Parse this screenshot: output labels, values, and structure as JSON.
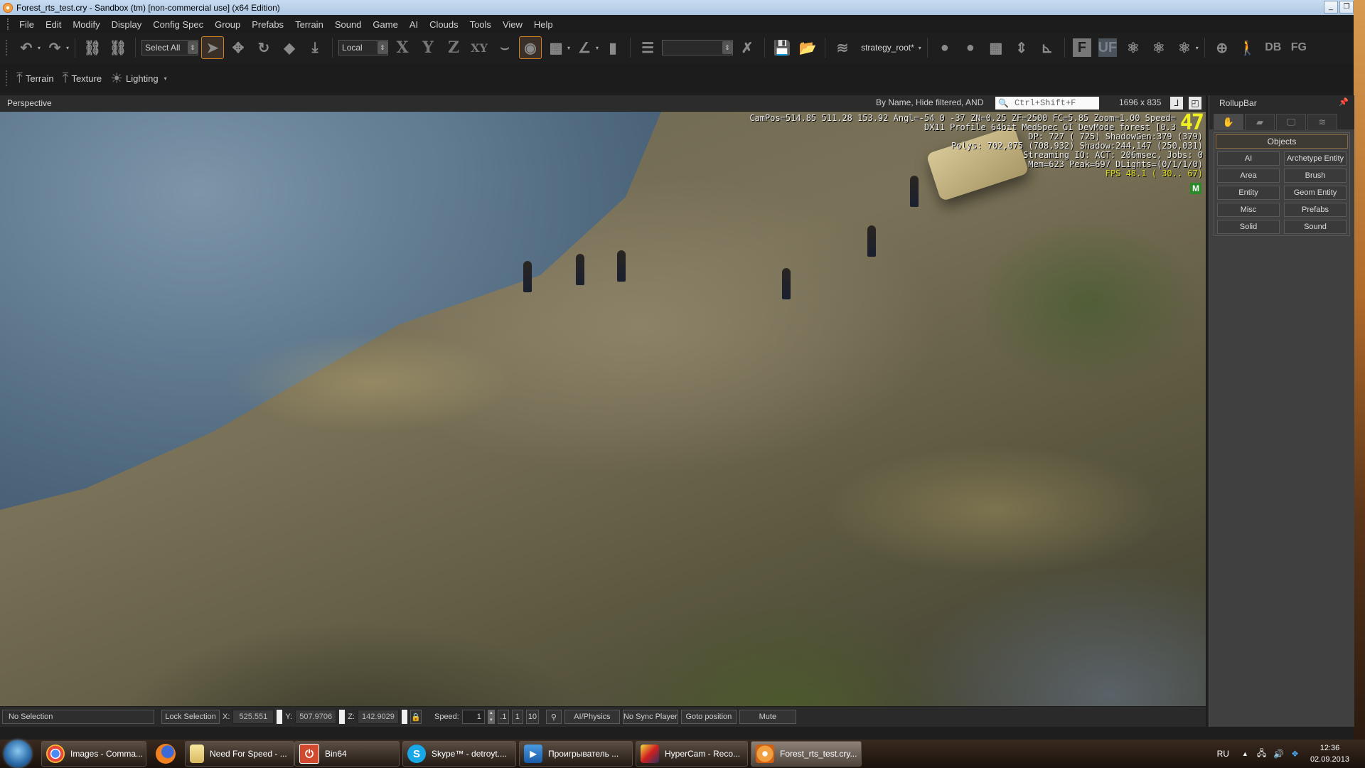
{
  "window": {
    "title": "Forest_rts_test.cry - Sandbox (tm) [non-commercial use] (x64 Edition)",
    "controls": [
      "minimize",
      "restore"
    ]
  },
  "menu": [
    "File",
    "Edit",
    "Modify",
    "Display",
    "Config Spec",
    "Group",
    "Prefabs",
    "Terrain",
    "Sound",
    "Game",
    "AI",
    "Clouds",
    "Tools",
    "View",
    "Help"
  ],
  "toolbar": {
    "selection_combo": "Select All",
    "coord_system_combo": "Local",
    "axis_x": "X",
    "axis_y": "Y",
    "axis_z": "Z",
    "axis_xy": "XY",
    "layer_name": "strategy_root*",
    "physics_f": "F",
    "physics_uf": "UF",
    "debug_db": "DB",
    "debug_fg": "FG"
  },
  "toolbar2": {
    "terrain": "Terrain",
    "texture": "Texture",
    "lighting": "Lighting"
  },
  "viewport_header": {
    "title": "Perspective",
    "filter_text": "By Name, Hide filtered, AND",
    "search_placeholder": "Ctrl+Shift+F",
    "resolution": "1696 x 835"
  },
  "hud": {
    "lines": [
      "CamPos=514.85 511.28 153.92 Angl=-54  0 -37 ZN=0.25 ZF=2500 FC=5.85 Zoom=1.00 Speed=",
      "DX11 Profile 64bit MedSpec GI DevMode forest [0.3",
      "DP:  727 ( 725) ShadowGen:379 (379)",
      "Polys: 702,075 (708,932) Shadow:244,147 (250,031)",
      "Streaming IO: ACT: 206msec, Jobs: 0",
      "Mem=623 Peak=697 DLights=(0/1/1/0)"
    ],
    "fps_line": "FPS  48.1 ( 30.. 67)",
    "speed_value": "47",
    "m_badge": "M",
    "fps_color": "#e0e020"
  },
  "statusbar": {
    "selection": "No Selection",
    "lock_selection": "Lock Selection",
    "x_label": "X:",
    "x_value": "525.551",
    "y_label": "Y:",
    "y_value": "507.9706",
    "z_label": "Z:",
    "z_value": "142.9029",
    "speed_label": "Speed:",
    "speed_value": "1",
    "speed_presets": [
      ".1",
      "1",
      "10"
    ],
    "ai_physics": "AI/Physics",
    "no_sync_player": "No Sync Player",
    "goto_position": "Goto position",
    "mute": "Mute"
  },
  "rollup": {
    "title": "RollupBar",
    "tabs": [
      "objects-tab",
      "terrain-tab",
      "display-tab",
      "layers-tab"
    ],
    "section_title": "Objects",
    "buttons": [
      "AI",
      "Archetype Entity",
      "Area",
      "Brush",
      "Entity",
      "Geom Entity",
      "Misc",
      "Prefabs",
      "Solid",
      "Sound"
    ]
  },
  "taskbar": {
    "items": [
      {
        "label": "Images - Comma...",
        "icon": "chrome-icon"
      },
      {
        "label": "",
        "icon": "firefox-icon"
      },
      {
        "label": "Need For Speed - ...",
        "icon": "folder-icon"
      },
      {
        "label": "Bin64",
        "icon": "power-icon"
      },
      {
        "label": "Skype™ - detroyt....",
        "icon": "skype-icon"
      },
      {
        "label": "Проигрыватель ...",
        "icon": "media-player-icon"
      },
      {
        "label": "HyperCam - Reco...",
        "icon": "hypercam-icon"
      },
      {
        "label": "Forest_rts_test.cry...",
        "icon": "sandbox-icon"
      }
    ],
    "language": "RU",
    "time": "12:36",
    "date": "02.09.2013"
  },
  "colors": {
    "accent_orange": "#d08020",
    "background": "#1e1e1e",
    "panel": "#404040"
  }
}
